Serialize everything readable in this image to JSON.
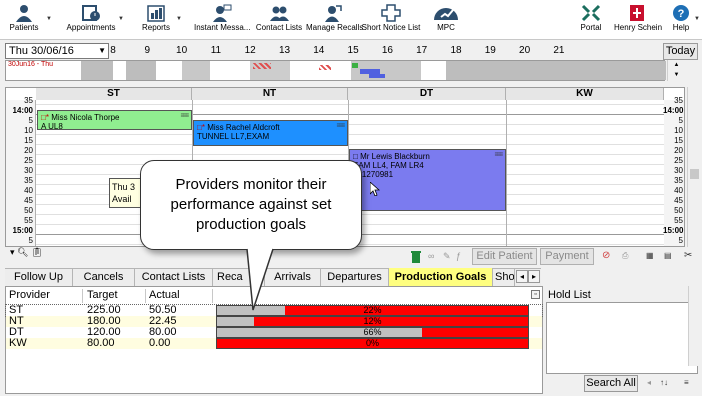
{
  "toolbar": {
    "items": [
      {
        "label": "Patients",
        "icon": "person-icon"
      },
      {
        "label": "Appointments",
        "icon": "calendar-clock-icon"
      },
      {
        "label": "Reports",
        "icon": "bar-chart-icon"
      },
      {
        "label": "Instant Messa...",
        "icon": "message-person-icon"
      },
      {
        "label": "Contact Lists",
        "icon": "contacts-icon"
      },
      {
        "label": "Manage Recalls",
        "icon": "recall-icon"
      },
      {
        "label": "Short Notice List",
        "icon": "short-notice-icon"
      },
      {
        "label": "MPC",
        "icon": "gauge-icon"
      },
      {
        "label": "Portal",
        "icon": "portal-icon"
      },
      {
        "label": "Henry Schein",
        "icon": "henry-schein-logo"
      },
      {
        "label": "Help",
        "icon": "help-icon"
      }
    ]
  },
  "date_bar": {
    "date": "Thu 30/06/16",
    "hours": [
      "8",
      "9",
      "10",
      "11",
      "12",
      "13",
      "14",
      "15",
      "16",
      "17",
      "18",
      "19",
      "20",
      "21"
    ],
    "today_label": "Today",
    "overview_date": "30Jun16 - Thu"
  },
  "schedule": {
    "columns": [
      "ST",
      "NT",
      "DT",
      "KW"
    ],
    "time_labels": [
      "35",
      "14:00",
      "5",
      "10",
      "15",
      "20",
      "25",
      "30",
      "35",
      "40",
      "45",
      "50",
      "55",
      "15:00",
      "5"
    ],
    "appointments": [
      {
        "name": "Miss Nicola Thorpe",
        "detail": "A UL8",
        "dots": "≡≡≡"
      },
      {
        "name": "Miss Rachel Aldcroft",
        "detail": "TUNNEL LL7,EXAM",
        "dots": "≡≡≡"
      },
      {
        "name": "Mr Lewis Blackburn",
        "detail": "EAM LL4, FAM LR4",
        "phone": "161270981",
        "dots": "≡≡≡"
      }
    ],
    "popup": {
      "line1": "Thu 3",
      "line2": "Avail"
    }
  },
  "callout": {
    "text": "Providers monitor their performance against set production goals"
  },
  "action_bar": {
    "edit_patient": "Edit Patient",
    "payment": "Payment"
  },
  "tabs": [
    "Follow Up",
    "Cancels",
    "Contact Lists",
    "Reca",
    "Arrivals",
    "Departures",
    "Production Goals",
    "Sho"
  ],
  "active_tab": "Production Goals",
  "production_goals": {
    "headers": [
      "Provider",
      "Target",
      "Actual"
    ],
    "rows": [
      {
        "provider": "ST",
        "target": "225.00",
        "actual": "50.50",
        "pct_label": "22%",
        "pct": 22
      },
      {
        "provider": "NT",
        "target": "180.00",
        "actual": "22.45",
        "pct_label": "12%",
        "pct": 12
      },
      {
        "provider": "DT",
        "target": "120.00",
        "actual": "80.00",
        "pct_label": "66%",
        "pct": 66
      },
      {
        "provider": "KW",
        "target": "80.00",
        "actual": "0.00",
        "pct_label": "0%",
        "pct": 0
      }
    ]
  },
  "hold_list": {
    "title": "Hold List",
    "search_all": "Search All"
  },
  "colors": {
    "st_appt": "#90ee90",
    "nt_appt": "#1e90ff",
    "dt_appt": "#7b7bef",
    "active_tab": "#ffff80",
    "bar_red": "#ff0000",
    "bar_fill": "#c0c0c0"
  }
}
